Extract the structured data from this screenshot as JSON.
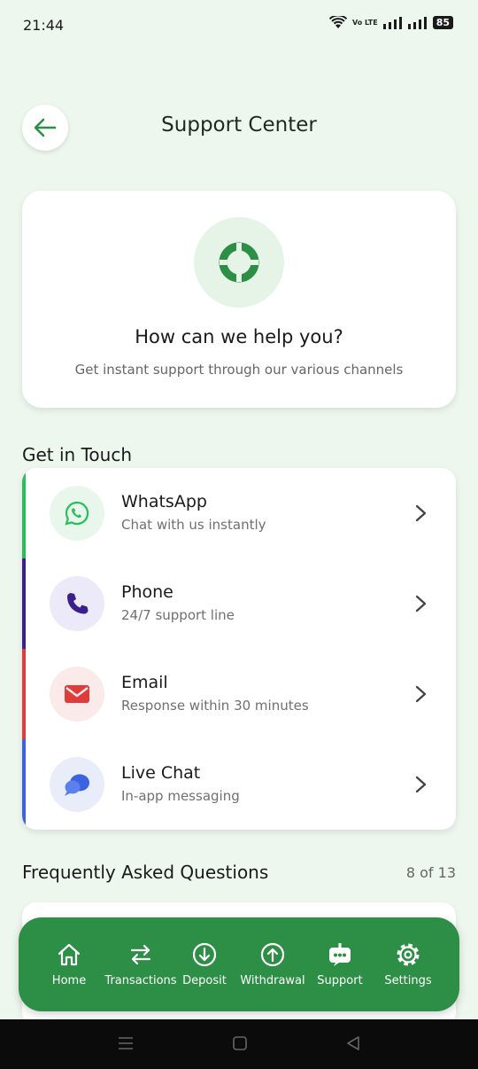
{
  "status_bar": {
    "time": "21:44",
    "network": "Vo LTE",
    "battery": "85"
  },
  "header": {
    "title": "Support Center"
  },
  "hero": {
    "title": "How can we help you?",
    "subtitle": "Get instant support through our various channels"
  },
  "contact": {
    "section_title": "Get in Touch",
    "items": [
      {
        "name": "WhatsApp",
        "desc": "Chat with us instantly",
        "color": "#25c05a",
        "icon": "whatsapp-icon"
      },
      {
        "name": "Phone",
        "desc": "24/7 support line",
        "color": "#3b1f8f",
        "icon": "phone-icon"
      },
      {
        "name": "Email",
        "desc": "Response within 30 minutes",
        "color": "#e03a3a",
        "icon": "mail-icon"
      },
      {
        "name": "Live Chat",
        "desc": "In-app messaging",
        "color": "#3b63e0",
        "icon": "chat-bubble-icon"
      }
    ]
  },
  "faq": {
    "title": "Frequently Asked Questions",
    "count": "8 of 13"
  },
  "bottom_nav": {
    "items": [
      {
        "label": "Home",
        "icon": "home-icon"
      },
      {
        "label": "Transactions",
        "icon": "arrows-swap-icon"
      },
      {
        "label": "Deposit",
        "icon": "download-circle-icon"
      },
      {
        "label": "Withdrawal",
        "icon": "upload-circle-icon"
      },
      {
        "label": "Support",
        "icon": "robot-icon"
      },
      {
        "label": "Settings",
        "icon": "gear-icon"
      }
    ]
  },
  "colors": {
    "brand": "#2d8f45",
    "background": "#eef7ee"
  }
}
